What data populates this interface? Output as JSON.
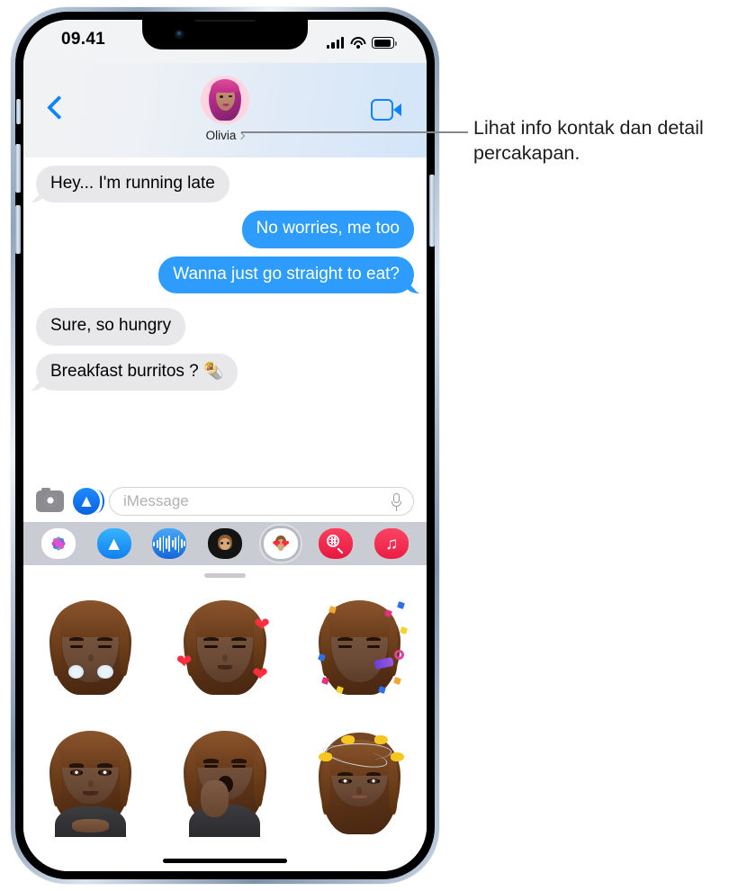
{
  "callout": {
    "text": "Lihat info kontak dan detail percakapan.",
    "leader_line": "leader-line"
  },
  "status_bar": {
    "time": "09.41",
    "signal_icon": "cellular-signal-icon",
    "wifi_icon": "wifi-icon",
    "battery_icon": "battery-icon"
  },
  "nav": {
    "back_icon": "back-chevron-icon",
    "contact_name": "Olivia",
    "contact_chevron_icon": "chevron-right-icon",
    "avatar_icon": "contact-avatar-memoji",
    "video_call_icon": "facetime-video-icon"
  },
  "conversation": {
    "messages": [
      {
        "text": "Hey... I'm running late",
        "side": "in",
        "tail": true
      },
      {
        "text": "No worries, me too",
        "side": "out",
        "tail": false
      },
      {
        "text": "Wanna just go straight to eat?",
        "side": "out",
        "tail": true
      },
      {
        "text": "Sure, so hungry",
        "side": "in",
        "tail": false
      },
      {
        "text": "Breakfast burritos ?",
        "side": "in",
        "tail": true,
        "emoji": "🌯"
      }
    ],
    "sent_sticker_name": "memoji-sticker-chefs-kiss"
  },
  "input_bar": {
    "camera_icon": "camera-icon",
    "appstore_icon": "app-store-icon",
    "placeholder": "iMessage",
    "value": "",
    "mic_icon": "microphone-icon"
  },
  "app_drawer": {
    "items": [
      {
        "name": "photos-app-icon",
        "label": "Photos",
        "selected": false
      },
      {
        "name": "app-store-app-icon",
        "label": "App Store",
        "selected": false
      },
      {
        "name": "digital-touch-app-icon",
        "label": "Digital Touch",
        "selected": false
      },
      {
        "name": "memoji-app-icon",
        "label": "Memoji",
        "selected": false
      },
      {
        "name": "stickers-app-icon",
        "label": "Memoji Stickers",
        "selected": true
      },
      {
        "name": "images-app-icon",
        "label": "#images",
        "selected": false
      },
      {
        "name": "music-app-icon",
        "label": "Music",
        "selected": false
      }
    ]
  },
  "sticker_tray": {
    "handle_icon": "drag-handle",
    "stickers": [
      {
        "name": "memoji-sticker-steam-nose",
        "label": "Frustrated"
      },
      {
        "name": "memoji-sticker-hearts",
        "label": "In love"
      },
      {
        "name": "memoji-sticker-party-horn",
        "label": "Celebrate"
      },
      {
        "name": "memoji-sticker-smile",
        "label": "Smiling"
      },
      {
        "name": "memoji-sticker-yawn",
        "label": "Yawning"
      },
      {
        "name": "memoji-sticker-birds",
        "label": "Dizzy birds"
      }
    ],
    "home_indicator": "home-indicator"
  },
  "colors": {
    "imessage_blue": "#2d9cfd",
    "received_gray": "#e8e8ea",
    "accent_blue": "#0a84ff",
    "drawer_gray": "#c9ccd3"
  }
}
